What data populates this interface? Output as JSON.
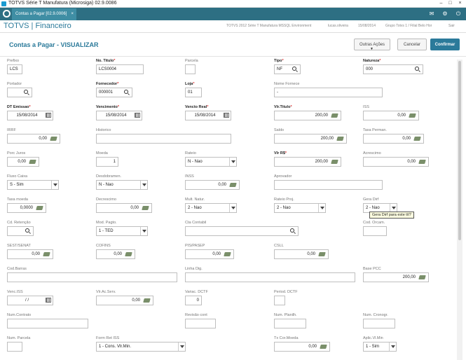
{
  "window": {
    "title": "TOTVS Série T Manufatura (Microsiga) 02.9.0086"
  },
  "tabs": {
    "active_label": "Contas a Pagar [02.9.0006]",
    "close": "×"
  },
  "header": {
    "brand": "TOTVS | Financeiro",
    "environment": "TOTVS 2012 Série T Manufatura MSSQL Environment",
    "user": "lucas.oliveira",
    "date": "15/08/2014",
    "branch": "Grupo Totvs 1 / Filial Belo Hor",
    "exit": "Sair"
  },
  "page": {
    "title": "Contas a Pagar - VISUALIZAR",
    "other_actions": "Outras Ações",
    "cancel": "Cancelar",
    "confirm": "Confirmar"
  },
  "tooltip": "Gera Dirf para este tít?",
  "form": {
    "prefixo": {
      "label": "Prefixo",
      "value": "LCS"
    },
    "titulo": {
      "label": "No. Titulo",
      "value": "LCS0004"
    },
    "parcela": {
      "label": "Parcela",
      "value": ""
    },
    "tipo": {
      "label": "Tipo",
      "value": "NF"
    },
    "natureza": {
      "label": "Natureza",
      "value": "000"
    },
    "portador": {
      "label": "Portador",
      "value": ""
    },
    "fornecedor": {
      "label": "Fornecedor",
      "value": "000001"
    },
    "loja": {
      "label": "Loja",
      "value": "01"
    },
    "nome_forn": {
      "label": "Nome Fornece",
      "value": "-"
    },
    "dt_emissao": {
      "label": "DT Emissao",
      "value": "15/08/2014"
    },
    "vencimento": {
      "label": "Vencimento",
      "value": "15/08/2014"
    },
    "vencto_real": {
      "label": "Vencto Real",
      "value": "15/08/2014"
    },
    "vlr_titulo": {
      "label": "Vlr.Titulo",
      "value": "200,00"
    },
    "iss": {
      "label": "ISS",
      "value": "0,00"
    },
    "irrf": {
      "label": "IRRF",
      "value": "0,00"
    },
    "historico": {
      "label": "Historico",
      "value": ""
    },
    "saldo": {
      "label": "Saldo",
      "value": "200,00"
    },
    "taxa_perm": {
      "label": "Taxa Perman.",
      "value": "0,00"
    },
    "porc_juros": {
      "label": "Porc Juros",
      "value": "0,00"
    },
    "moeda": {
      "label": "Moeda",
      "value": "1"
    },
    "rateio": {
      "label": "Rateio",
      "value": "N - Nao"
    },
    "vlr_rs": {
      "label": "Vlr R$",
      "value": "200,00"
    },
    "acrescimo": {
      "label": "Acrescimo",
      "value": "0,00"
    },
    "fluxo_caixa": {
      "label": "Fluxo Caixa",
      "value": "S - Sim"
    },
    "desdobr": {
      "label": "Desdobramen.",
      "value": "N - Nao"
    },
    "inss": {
      "label": "INSS",
      "value": "0,00"
    },
    "aprovador": {
      "label": "Aprovador",
      "value": ""
    },
    "taxa_moeda": {
      "label": "Taxa moeda",
      "value": "0,0000"
    },
    "decrescimo": {
      "label": "Decrescimo",
      "value": "0,00"
    },
    "mult_natur": {
      "label": "Mult. Natur.",
      "value": "2 - Nao"
    },
    "rateio_proj": {
      "label": "Rateio Proj.",
      "value": "2 - Nao"
    },
    "gera_dirf": {
      "label": "Gera Dirf",
      "value": "2 - Nao"
    },
    "cd_retencao": {
      "label": "Cd. Retenção",
      "value": ""
    },
    "mod_pagto": {
      "label": "Mod. Pagto.",
      "value": "1 - TED"
    },
    "cta_contabil": {
      "label": "Cta Contabil",
      "value": ""
    },
    "cod_orcam": {
      "label": "Cod. Orcam.",
      "value": ""
    },
    "sest_senat": {
      "label": "SEST/SENAT",
      "value": "0,00"
    },
    "cofins": {
      "label": "COFINS",
      "value": "0,00"
    },
    "pis_pasep": {
      "label": "PIS/PASEP",
      "value": "0,00"
    },
    "csll": {
      "label": "CSLL",
      "value": "0,00"
    },
    "cod_barras": {
      "label": "Cod.Barras",
      "value": ""
    },
    "linha_dig": {
      "label": "Linha Dig.",
      "value": ""
    },
    "base_pcc": {
      "label": "Base PCC",
      "value": "200,00"
    },
    "venc_iss": {
      "label": "Venc.ISS",
      "value": "/ /"
    },
    "vlr_ac_serv": {
      "label": "Vlr.Ac.Serv.",
      "value": "0,00"
    },
    "variac_dctf": {
      "label": "Variac. DCTF",
      "value": "0"
    },
    "period_dctf": {
      "label": "Period. DCTF",
      "value": ""
    },
    "num_contrato": {
      "label": "Num.Contrato",
      "value": ""
    },
    "revisao_cont": {
      "label": "Revisão cont",
      "value": ""
    },
    "num_planilh": {
      "label": "Num. Planilh.",
      "value": ""
    },
    "num_cronogr": {
      "label": "Num. Cronogr.",
      "value": ""
    },
    "num_parcela": {
      "label": "Num. Parcela",
      "value": ""
    },
    "form_ret_iss": {
      "label": "Form Ret ISS",
      "value": "1 - Cons. Vlr.Min."
    },
    "tx_cor_moeda": {
      "label": "Tx Cor.Moeda",
      "value": "0,00"
    },
    "aplic_vl_min": {
      "label": "Aplic.Vl.Min",
      "value": "1 - Sim"
    }
  }
}
